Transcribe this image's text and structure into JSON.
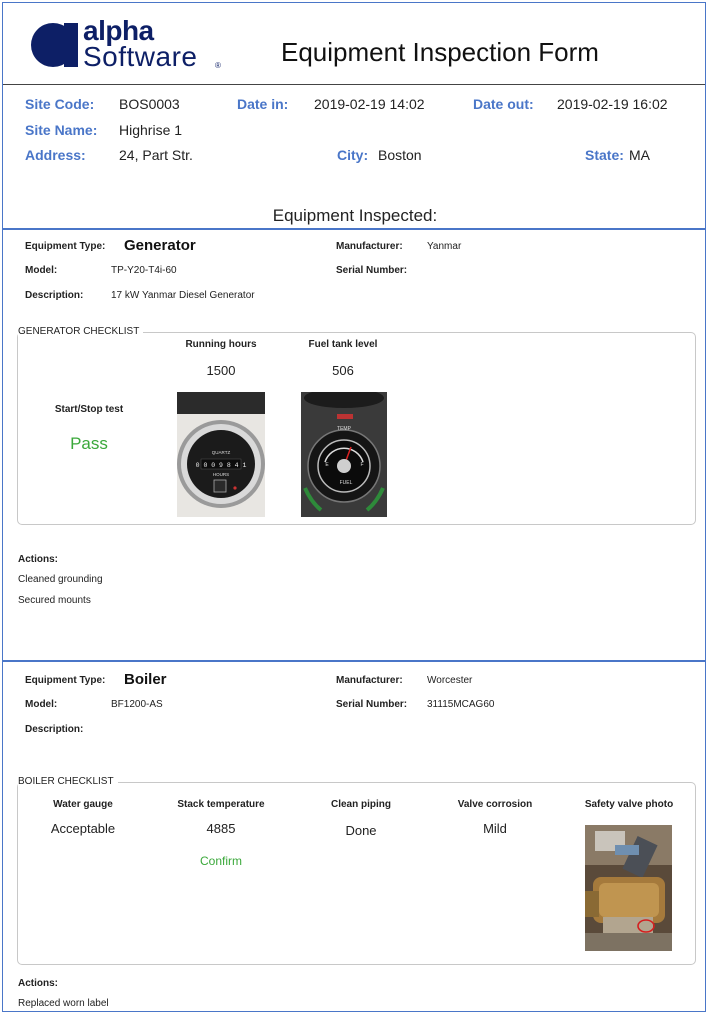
{
  "header": {
    "logo_word_top": "alpha",
    "logo_word_bottom": "Software",
    "logo_reg": "®",
    "title": "Equipment Inspection Form"
  },
  "site": {
    "site_code_label": "Site Code:",
    "site_code": "BOS0003",
    "date_in_label": "Date in:",
    "date_in": "2019-02-19 14:02",
    "date_out_label": "Date out:",
    "date_out": "2019-02-19 16:02",
    "site_name_label": "Site Name:",
    "site_name": "Highrise 1",
    "address_label": "Address:",
    "address": "24, Part Str.",
    "city_label": "City:",
    "city": "Boston",
    "state_label": "State:",
    "state": "MA"
  },
  "section_title": "Equipment Inspected:",
  "equipment": [
    {
      "type_label": "Equipment Type:",
      "type": "Generator",
      "manufacturer_label": "Manufacturer:",
      "manufacturer": "Yanmar",
      "model_label": "Model:",
      "model": "TP-Y20-T4i-60",
      "serial_label": "Serial Number:",
      "serial": "",
      "description_label": "Description:",
      "description": "17 kW Yanmar Diesel Generator",
      "checklist_title": "GENERATOR CHECKLIST",
      "checklist": {
        "start_stop_label": "Start/Stop test",
        "start_stop_value": "Pass",
        "running_hours_label": "Running hours",
        "running_hours_value": "1500",
        "fuel_label": "Fuel tank level",
        "fuel_value": "506",
        "hour_meter_text_top": "QUARTZ",
        "hour_meter_digits": "0 0 0 9 8 4 1",
        "hour_meter_text_bottom": "HOURS",
        "fuel_gauge_temp": "TEMP",
        "fuel_gauge_fuel": "FUEL",
        "fuel_gauge_e": "E",
        "fuel_gauge_f": "F"
      },
      "actions_label": "Actions:",
      "actions": [
        "Cleaned grounding",
        "Secured mounts"
      ]
    },
    {
      "type_label": "Equipment Type:",
      "type": "Boiler",
      "manufacturer_label": "Manufacturer:",
      "manufacturer": "Worcester",
      "model_label": "Model:",
      "model": "BF1200-AS",
      "serial_label": "Serial Number:",
      "serial": "31115MCAG60",
      "description_label": "Description:",
      "description": "",
      "checklist_title": "BOILER CHECKLIST",
      "checklist": {
        "water_gauge_label": "Water gauge",
        "water_gauge_value": "Acceptable",
        "stack_temp_label": "Stack temperature",
        "stack_temp_value": "4885",
        "stack_temp_status": "Confirm",
        "clean_piping_label": "Clean piping",
        "clean_piping_value": "Done",
        "valve_corrosion_label": "Valve corrosion",
        "valve_corrosion_value": "Mild",
        "safety_valve_label": "Safety valve photo"
      },
      "actions_label": "Actions:",
      "actions": [
        "Replaced worn label"
      ]
    }
  ],
  "colors": {
    "accent_blue": "#4a76c8",
    "pass_green": "#3aa83a",
    "logo_navy": "#0d1f66"
  }
}
